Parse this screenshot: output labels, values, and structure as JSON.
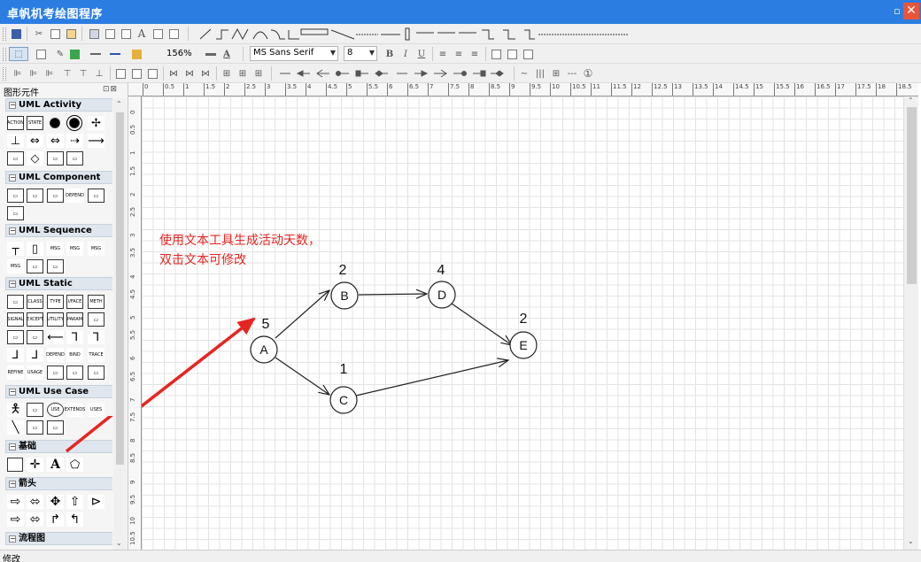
{
  "window": {
    "title": "卓帆机考绘图程序",
    "restore_glyph": "▫",
    "close_glyph": "✕"
  },
  "toolbar": {
    "zoom": "156%",
    "font_name": "MS Sans Serif",
    "font_size": "8",
    "font_color_glyph": "A",
    "step_label": "①"
  },
  "panel": {
    "title": "图形元件",
    "groups": [
      {
        "label": "UML Activity"
      },
      {
        "label": "UML Component"
      },
      {
        "label": "UML Sequence"
      },
      {
        "label": "UML Static"
      },
      {
        "label": "UML Use Case"
      },
      {
        "label": "基础"
      },
      {
        "label": "箭头"
      },
      {
        "label": "流程图"
      }
    ],
    "items": {
      "action": "ACTION",
      "state": "STATE",
      "depend": "DEPEND",
      "msg": "MSG",
      "class": "CLASS",
      "type": "TYPE",
      "iface": "I/FACE",
      "meta": "METH",
      "signal": "SIGNAL",
      "except": "EXCEPT",
      "utility": "UTILITY",
      "param": "PARAM",
      "bind": "BIND",
      "trace": "TRACE",
      "refine": "REFINE",
      "usage": "USAGE",
      "use": "USE",
      "extends": "EXTENDS",
      "uses": "USES",
      "text_tool": "A"
    }
  },
  "diagram": {
    "annotation_line1": "使用文本工具生成活动天数，",
    "annotation_line2": "双击文本可修改",
    "nodes": [
      {
        "id": "A",
        "label": "A",
        "value": "5"
      },
      {
        "id": "B",
        "label": "B",
        "value": "2"
      },
      {
        "id": "C",
        "label": "C",
        "value": "1"
      },
      {
        "id": "D",
        "label": "D",
        "value": "4"
      },
      {
        "id": "E",
        "label": "E",
        "value": "2"
      }
    ],
    "edges": [
      [
        "A",
        "B"
      ],
      [
        "A",
        "C"
      ],
      [
        "B",
        "D"
      ],
      [
        "D",
        "E"
      ],
      [
        "C",
        "E"
      ]
    ],
    "accent_color": "#e52521"
  },
  "ruler": {
    "top": [
      "0",
      "0.5",
      "1",
      "1.5",
      "2",
      "2.5",
      "3",
      "3.5",
      "4",
      "4.5",
      "5",
      "5.5",
      "6",
      "6.5",
      "7",
      "7.5",
      "8",
      "8.5",
      "9",
      "9.5",
      "10",
      "10.5",
      "11",
      "11.5",
      "12",
      "12.5",
      "13",
      "13.5",
      "14",
      "14.5",
      "15",
      "15.5",
      "16",
      "16.5",
      "17",
      "17.5",
      "18",
      "18.5"
    ],
    "left": [
      "0",
      "0.5",
      "1",
      "1.5",
      "2",
      "2.5",
      "3",
      "3.5",
      "4",
      "4.5",
      "5",
      "5.5",
      "6",
      "6.5",
      "7",
      "7.5",
      "8",
      "8.5",
      "9",
      "9.5",
      "10",
      "10.5"
    ]
  },
  "status": {
    "text": "修改"
  }
}
